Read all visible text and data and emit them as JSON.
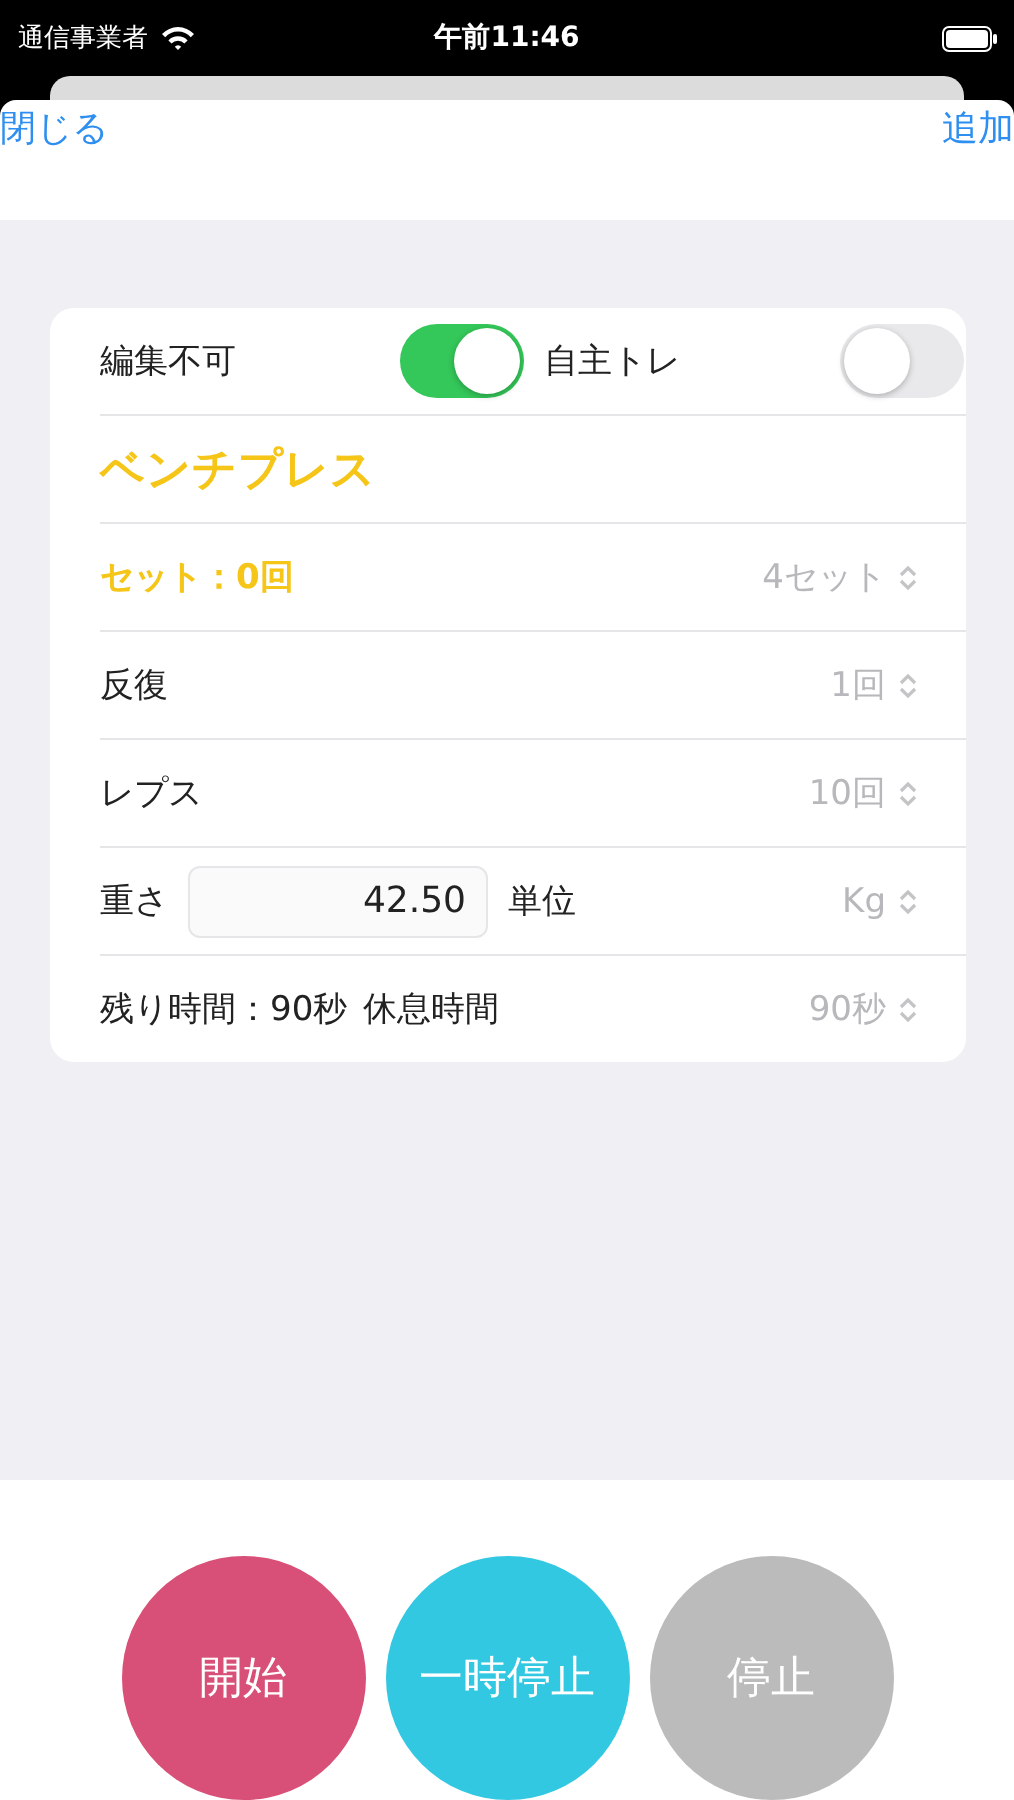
{
  "status_bar": {
    "carrier": "通信事業者",
    "time": "午前11:46"
  },
  "nav": {
    "left": "閉じる",
    "right": "追加"
  },
  "toggles": [
    {
      "label": "編集不可",
      "on": true
    },
    {
      "label": "自主トレ",
      "on": false
    }
  ],
  "exercise": "ベンチプレス",
  "rows": [
    {
      "kind": "picker",
      "label": "セット：0回",
      "value": "4セット",
      "highlight": true
    },
    {
      "kind": "picker",
      "label": "反復",
      "value": "1回",
      "highlight": false
    },
    {
      "kind": "picker",
      "label": "レプス",
      "value": "10回",
      "highlight": false
    },
    {
      "kind": "weight",
      "label": "重さ",
      "value": "42.50",
      "unit_label": "単位",
      "unit": "Kg",
      "highlight": false
    },
    {
      "kind": "picker",
      "label": "残り時間：90秒",
      "sublabel": "休息時間",
      "value": "90秒",
      "highlight": false
    }
  ],
  "buttons": [
    {
      "label": "開始",
      "color": "#d84f77"
    },
    {
      "label": "一時停止",
      "color": "#33c8e2"
    },
    {
      "label": "停止",
      "color": "#bbbbbb"
    }
  ]
}
